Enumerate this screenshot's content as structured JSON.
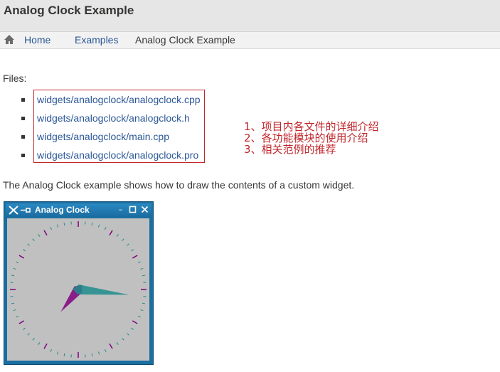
{
  "page": {
    "title": "Analog Clock Example"
  },
  "breadcrumb": {
    "items": [
      {
        "label": "Home"
      },
      {
        "label": "Examples"
      },
      {
        "label": "Analog Clock Example"
      }
    ]
  },
  "files": {
    "label": "Files:",
    "items": [
      "widgets/analogclock/analogclock.cpp",
      "widgets/analogclock/analogclock.h",
      "widgets/analogclock/main.cpp",
      "widgets/analogclock/analogclock.pro"
    ]
  },
  "annotations": [
    "1、项目内各文件的详细介绍",
    "2、各功能模块的使用介绍",
    "3、相关范例的推荐"
  ],
  "description": "The Analog Clock example shows how to draw the contents of a custom widget.",
  "clock_window": {
    "title": "Analog Clock",
    "controls": [
      "minimize-icon",
      "maximize-icon",
      "close-icon"
    ],
    "hour_hand_color": "#7f007f",
    "minute_hand_color": "#1f8c8c",
    "time": {
      "hour": 7,
      "minute": 16
    }
  },
  "colors": {
    "link": "#2b5797",
    "annotation": "#c0272d",
    "header_bg": "#e6e6e6",
    "window_frame": "#1b6fa0"
  }
}
